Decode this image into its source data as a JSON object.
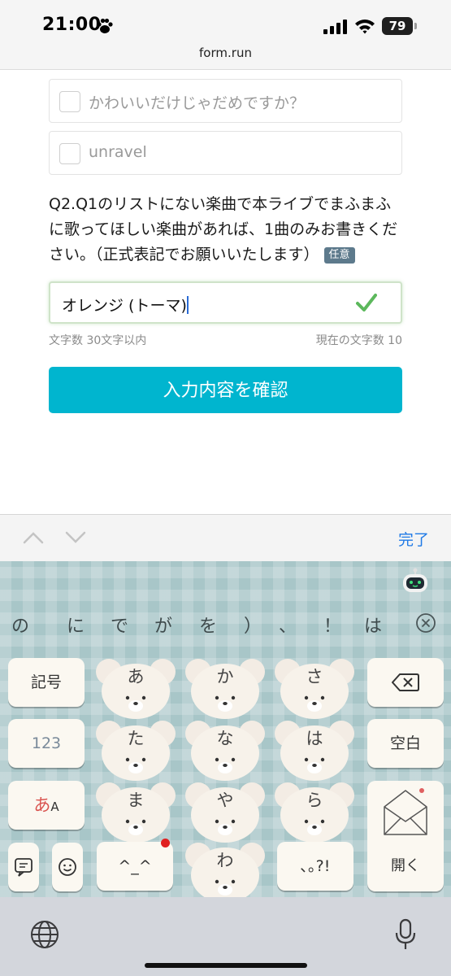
{
  "status_bar": {
    "time": "21:00",
    "battery": "79"
  },
  "browser": {
    "url": "form.run"
  },
  "form": {
    "choices": [
      {
        "label": "かわいいだけじゃだめですか？"
      },
      {
        "label": "unravel"
      }
    ],
    "question": "Q2.Q1のリストにない楽曲で本ライブでまふまふに歌ってほしい楽曲があれば、1曲のみお書きください。（正式表記でお願いいたします）",
    "optional_badge": "任意",
    "answer_value": "オレンジ (トーマ)",
    "hint_left": "文字数 30文字以内",
    "hint_right": "現在の文字数 10",
    "confirm_button": "入力内容を確認"
  },
  "accessory_bar": {
    "done_label": "完了",
    "icons": [
      "chevron-up-icon",
      "chevron-down-icon"
    ]
  },
  "keyboard": {
    "candidates": [
      "の",
      "に",
      "で",
      "が",
      "を",
      "）",
      "、",
      "！",
      "は"
    ],
    "keys": {
      "symbols": "記号",
      "numbers": "123",
      "kana_mode_main": "あ",
      "kana_mode_sub": "A",
      "a": "あ",
      "ka": "か",
      "sa": "さ",
      "ta": "た",
      "na": "な",
      "ha": "は",
      "ma": "ま",
      "ya": "や",
      "ra": "ら",
      "wa": "わ",
      "kaomoji": "^_^",
      "punct": "､｡?!",
      "space": "空白",
      "enter": "開く"
    },
    "colors": {
      "background": "#a8c6c8",
      "key": "#fbf8f1",
      "accent": "#00b5cf"
    }
  }
}
